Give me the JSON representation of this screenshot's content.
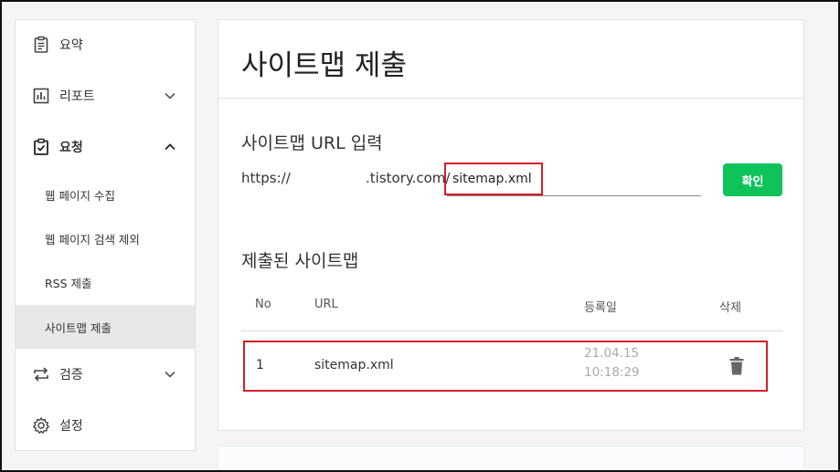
{
  "sidebar": {
    "items": [
      {
        "label": "요약",
        "icon": "clipboard-icon"
      },
      {
        "label": "리포트",
        "icon": "chart-icon"
      },
      {
        "label": "요청",
        "icon": "check-clipboard-icon"
      },
      {
        "label": "검증",
        "icon": "repeat-icon"
      },
      {
        "label": "설정",
        "icon": "gear-icon"
      }
    ],
    "sub_items": [
      {
        "label": "웹 페이지 수집"
      },
      {
        "label": "웹 페이지 검색 제외"
      },
      {
        "label": "RSS 제출"
      },
      {
        "label": "사이트맵 제출"
      }
    ]
  },
  "main": {
    "title": "사이트맵 제출",
    "url_section": {
      "title": "사이트맵 URL 입력",
      "prefix": "https://",
      "domain": ".tistory.com/",
      "input_value": "sitemap.xml",
      "confirm_label": "확인"
    },
    "submitted_section": {
      "title": "제출된 사이트맵",
      "columns": [
        "No",
        "URL",
        "등록일",
        "삭제"
      ],
      "rows": [
        {
          "no": "1",
          "url": "sitemap.xml",
          "date": "21.04.15 10:18:29"
        }
      ]
    }
  },
  "colors": {
    "accent_green": "#0ec35a",
    "highlight_red": "#d4202a",
    "active_bg": "#e8e8e8"
  }
}
